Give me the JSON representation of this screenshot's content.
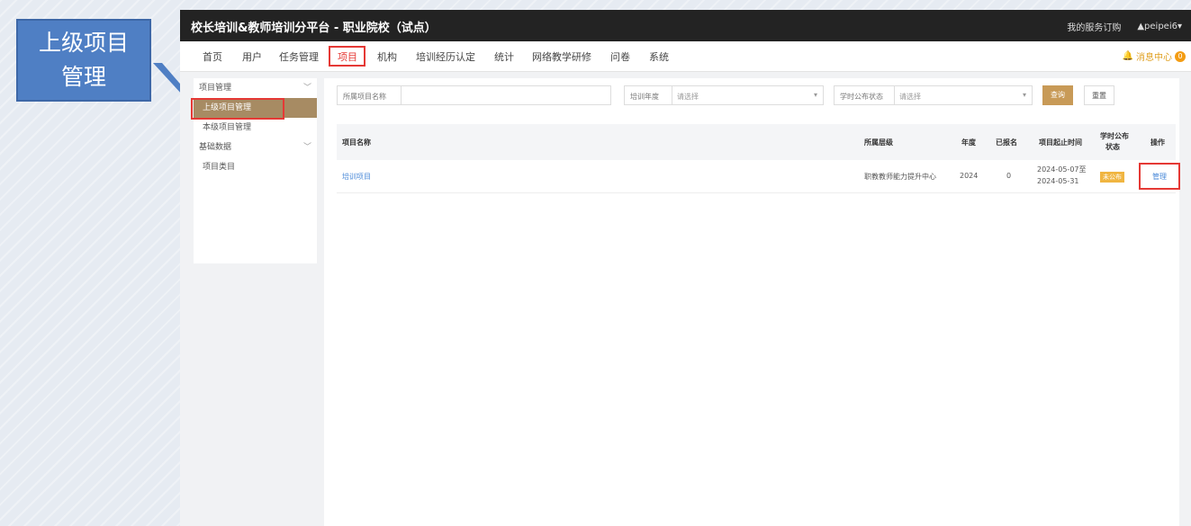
{
  "callout": {
    "line1": "上级项目",
    "line2": "管理"
  },
  "app": {
    "title": "校长培训&教师培训分平台 - 职业院校（试点）"
  },
  "topbar": {
    "service_link": "我的服务订购",
    "user": "▲peipei6▾"
  },
  "nav": {
    "items": [
      "首页",
      "用户",
      "任务管理",
      "项目",
      "机构",
      "培训经历认定",
      "统计",
      "网络教学研修",
      "问卷",
      "系统"
    ],
    "active_index": 3,
    "message_center": "消息中心",
    "message_count": "0"
  },
  "sidebar": {
    "group1": "项目管理",
    "item_superior": "上级项目管理",
    "item_local": "本级项目管理",
    "group2": "基础数据",
    "item_category": "项目类目"
  },
  "filters": {
    "project_name_label": "所属项目名称",
    "year_label": "培训年度",
    "year_placeholder": "请选择",
    "status_label": "学时公布状态",
    "status_placeholder": "请选择",
    "search_btn": "查询",
    "reset_btn": "重置"
  },
  "table": {
    "headers": {
      "name": "项目名称",
      "level": "所属层级",
      "year": "年度",
      "enrolled": "已报名",
      "period": "项目起止时间",
      "status1": "学时公布",
      "status2": "状态",
      "action": "操作"
    },
    "rows": [
      {
        "name": "培训项目",
        "level": "职教教师能力提升中心",
        "year": "2024",
        "enrolled": "0",
        "start": "2024-05-07至",
        "end": "2024-05-31",
        "status": "未公布",
        "action": "管理"
      }
    ]
  },
  "colors": {
    "accent": "#c89a57",
    "highlight": "#e53935",
    "callout": "#4f7fc4",
    "link": "#4b8ad8"
  }
}
